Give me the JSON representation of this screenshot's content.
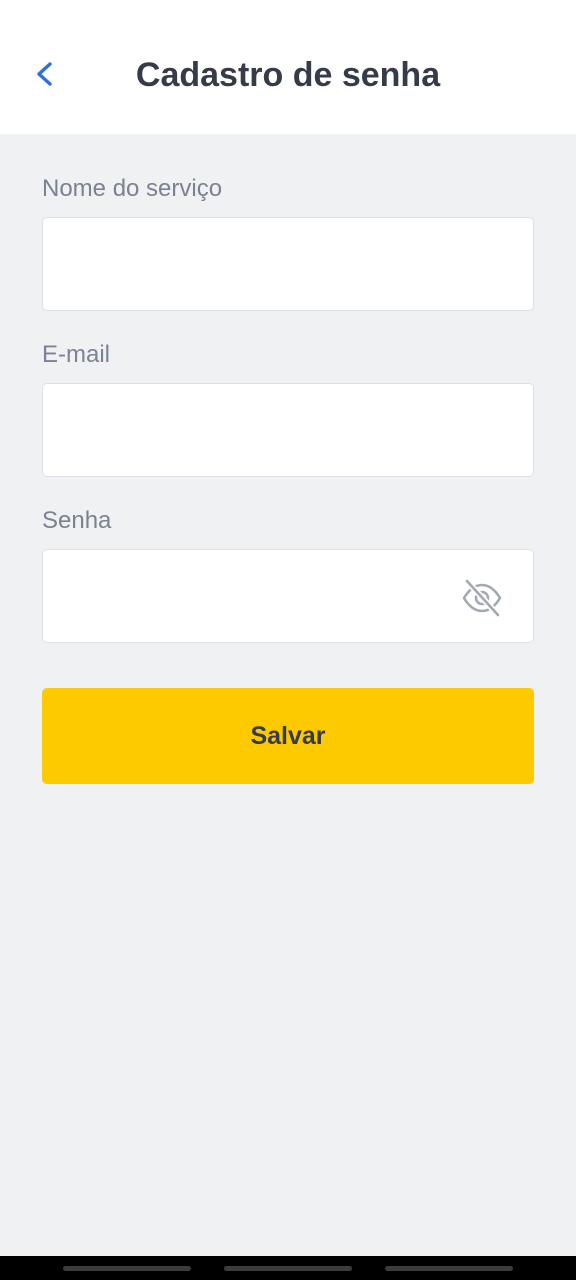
{
  "header": {
    "title": "Cadastro de senha",
    "back_icon": "chevron-left-icon",
    "accent_color": "#2f6fd6"
  },
  "form": {
    "service": {
      "label": "Nome do serviço",
      "value": "",
      "placeholder": ""
    },
    "email": {
      "label": "E-mail",
      "value": "",
      "placeholder": ""
    },
    "password": {
      "label": "Senha",
      "value": "",
      "placeholder": "",
      "toggle_icon": "eye-off-icon"
    }
  },
  "actions": {
    "save_label": "Salvar",
    "save_color": "#fdca00"
  }
}
